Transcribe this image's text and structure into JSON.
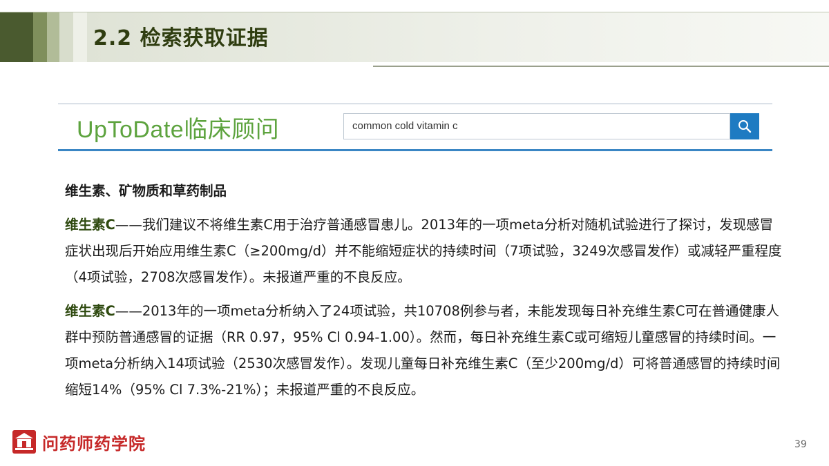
{
  "slide": {
    "title": "2.2  检索获取证据",
    "page_number": "39"
  },
  "uptodate": {
    "logo_text": "UpToDate临床顾问",
    "search_value": "common cold vitamin c",
    "search_icon": "search-icon",
    "brand_color": "#5da33e",
    "button_color": "#1e7bc2"
  },
  "content": {
    "heading": "维生素、矿物质和草药制品",
    "paragraphs": [
      {
        "lead": "维生素C",
        "text": "——我们建议不将维生素C用于治疗普通感冒患儿。2013年的一项meta分析对随机试验进行了探讨，发现感冒症状出现后开始应用维生素C（≥200mg/d）并不能缩短症状的持续时间（7项试验，3249次感冒发作）或减轻严重程度（4项试验，2708次感冒发作）。未报道严重的不良反应。"
      },
      {
        "lead": "维生素C",
        "text": "——2013年的一项meta分析纳入了24项试验，共10708例参与者，未能发现每日补充维生素C可在普通健康人群中预防普通感冒的证据（RR 0.97，95% Cl 0.94-1.00）。然而，每日补充维生素C或可缩短儿童感冒的持续时间。一项meta分析纳入14项试验（2530次感冒发作）。发现儿童每日补充维生素C（至少200mg/d）可将普通感冒的持续时间缩短14%（95% Cl 7.3%-21%）；未报道严重的不良反应。"
      }
    ]
  },
  "footer": {
    "logo_text": "问药师药学院",
    "logo_icon": "school-icon",
    "logo_color": "#c62828"
  }
}
